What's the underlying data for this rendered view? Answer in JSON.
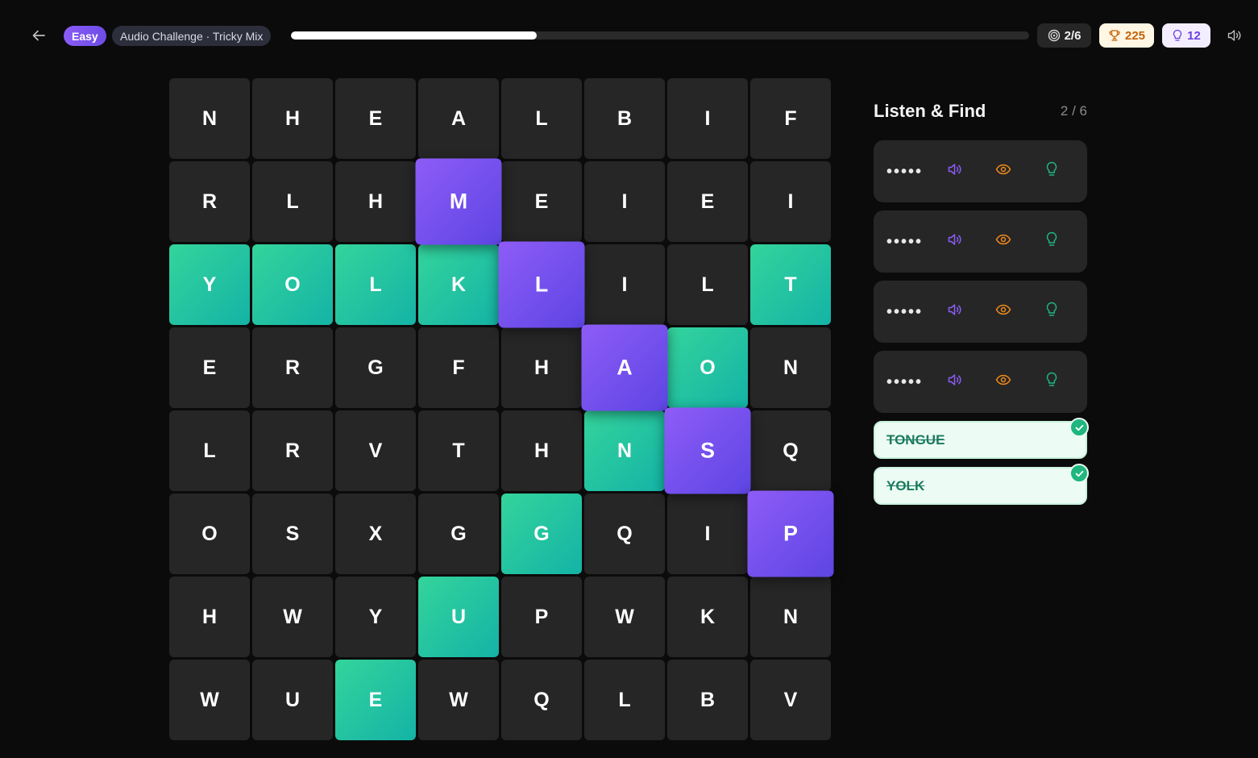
{
  "header": {
    "difficulty": "Easy",
    "mode": "Audio Challenge · Tricky Mix",
    "progress_fraction": 0.333,
    "found": "2/6",
    "score": "225",
    "hints": "12"
  },
  "panel": {
    "title": "Listen & Find",
    "count": "2 / 6",
    "hidden_words": [
      {
        "mask": "•••••"
      },
      {
        "mask": "•••••"
      },
      {
        "mask": "•••••"
      },
      {
        "mask": "•••••"
      }
    ],
    "found_words": [
      "TONGUE",
      "YOLK"
    ]
  },
  "colors": {
    "found": "#20c4a0",
    "selected": "#7251ee",
    "cell": "#262626",
    "audio_icon": "#8b5cf6",
    "eye_icon": "#f08a1c",
    "hint_icon": "#1fb67f"
  },
  "grid": {
    "rows": [
      [
        "N",
        "H",
        "E",
        "A",
        "L",
        "B",
        "I",
        "F"
      ],
      [
        "R",
        "L",
        "H",
        "M",
        "E",
        "I",
        "E",
        "I"
      ],
      [
        "Y",
        "O",
        "L",
        "K",
        "L",
        "I",
        "L",
        "T"
      ],
      [
        "E",
        "R",
        "G",
        "F",
        "H",
        "A",
        "O",
        "N"
      ],
      [
        "L",
        "R",
        "V",
        "T",
        "H",
        "N",
        "S",
        "Q"
      ],
      [
        "O",
        "S",
        "X",
        "G",
        "G",
        "Q",
        "I",
        "P"
      ],
      [
        "H",
        "W",
        "Y",
        "U",
        "P",
        "W",
        "K",
        "N"
      ],
      [
        "W",
        "U",
        "E",
        "W",
        "Q",
        "L",
        "B",
        "V"
      ]
    ],
    "states": [
      [
        "",
        "",
        "",
        "",
        "",
        "",
        "",
        ""
      ],
      [
        "",
        "",
        "",
        "sel",
        "",
        "",
        "",
        ""
      ],
      [
        "found",
        "found",
        "found",
        "found",
        "sel",
        "",
        "",
        "found"
      ],
      [
        "",
        "",
        "",
        "",
        "",
        "sel",
        "found",
        ""
      ],
      [
        "",
        "",
        "",
        "",
        "",
        "found",
        "sel",
        ""
      ],
      [
        "",
        "",
        "",
        "",
        "found",
        "",
        "",
        "sel"
      ],
      [
        "",
        "",
        "",
        "found",
        "",
        "",
        "",
        ""
      ],
      [
        "",
        "",
        "found",
        "",
        "",
        "",
        "",
        ""
      ]
    ]
  }
}
